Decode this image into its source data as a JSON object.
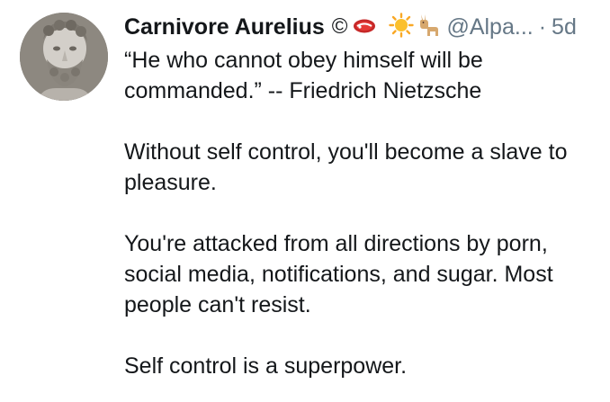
{
  "tweet": {
    "author": {
      "display_name": "Carnivore Aurelius",
      "name_symbol": "©",
      "name_emojis": [
        "steak-emoji",
        "sun-emoji",
        "llama-emoji"
      ],
      "handle": "@Alpa...",
      "separator": "·",
      "time": "5d"
    },
    "text": {
      "line_1": "“He who cannot obey himself will be",
      "line_2": "commanded.” -- Friedrich Nietzsche",
      "para_2_line_1": "Without self control, you'll become a slave to",
      "para_2_line_2": "pleasure.",
      "para_3_line_1": "You're attacked from all directions by porn,",
      "para_3_line_2": "social media, notifications, and sugar. Most",
      "para_3_line_3": "people can't resist.",
      "para_4_line_1": "Self control is a superpower."
    }
  },
  "colors": {
    "text_primary": "#14171a",
    "text_secondary": "#657786",
    "background": "#ffffff"
  }
}
